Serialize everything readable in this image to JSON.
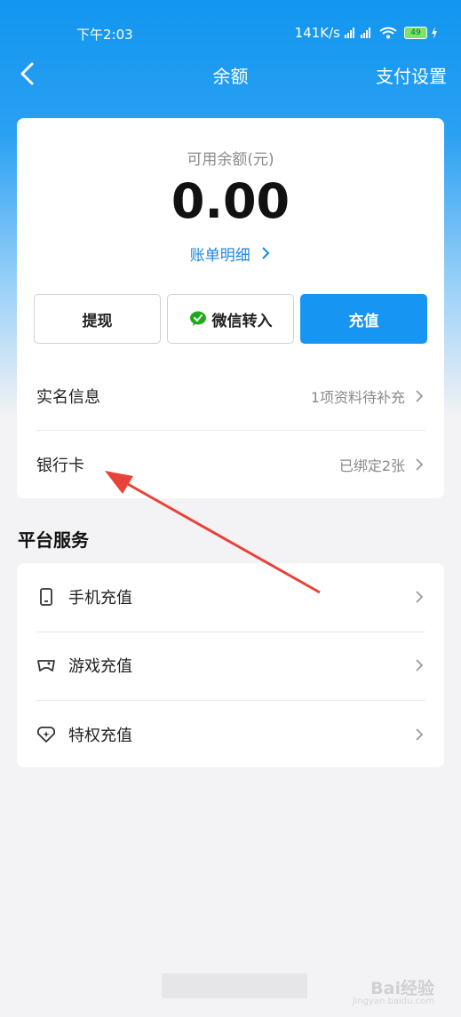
{
  "status_bar": {
    "time": "下午2:03",
    "speed": "141K/s",
    "battery": "49"
  },
  "nav": {
    "title": "余额",
    "action": "支付设置"
  },
  "balance": {
    "label": "可用余额(元)",
    "value": "0.00",
    "bill_link": "账单明细"
  },
  "actions": {
    "withdraw": "提现",
    "wechat_transfer": "微信转入",
    "top_up": "充值"
  },
  "account_rows": [
    {
      "label": "实名信息",
      "value": "1项资料待补充"
    },
    {
      "label": "银行卡",
      "value": "已绑定2张"
    }
  ],
  "platform_services": {
    "title": "平台服务",
    "items": [
      {
        "label": "手机充值",
        "icon": "phone-icon"
      },
      {
        "label": "游戏充值",
        "icon": "gamepad-icon"
      },
      {
        "label": "特权充值",
        "icon": "privilege-heart-icon"
      }
    ]
  },
  "watermark": {
    "text": "Bai经验",
    "sub": "jingyan.baidu.com"
  },
  "colors": {
    "primary": "#1795f3",
    "link": "#1a86e8",
    "annotation_arrow": "#e8423a"
  }
}
